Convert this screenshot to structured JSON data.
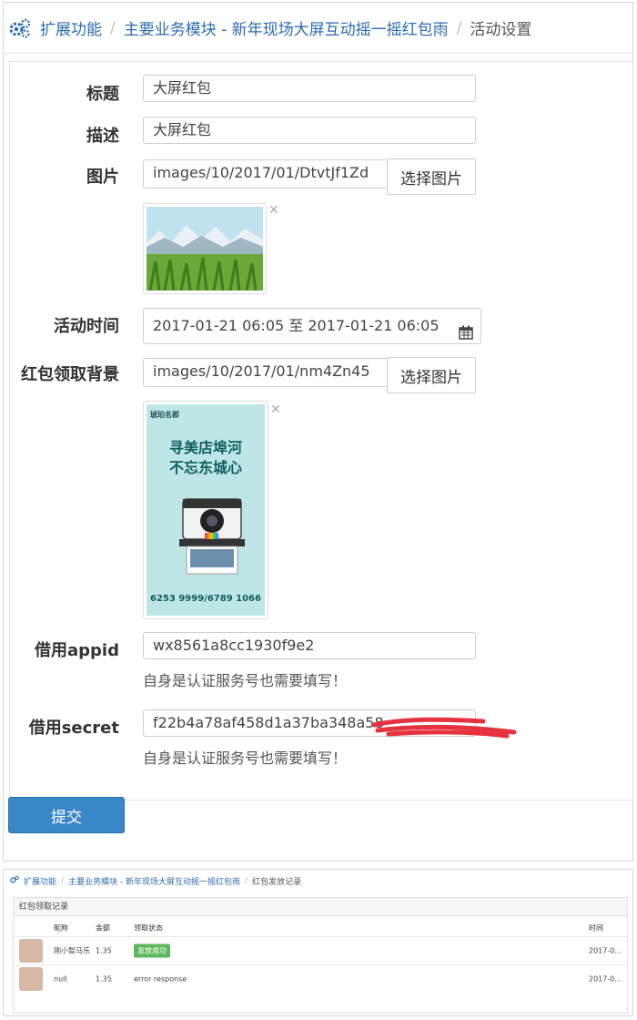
{
  "breadcrumb": {
    "icon": "gears-icon",
    "items": [
      "扩展功能",
      "主要业务模块 - 新年现场大屏互动摇一摇红包雨",
      "活动设置"
    ]
  },
  "form": {
    "title_label": "标题",
    "title_value": "大屏红包",
    "desc_label": "描述",
    "desc_value": "大屏红包",
    "image_label": "图片",
    "image_value": "images/10/2017/01/DtvtJf1Zd",
    "pick_image": "选择图片",
    "time_label": "活动时间",
    "time_value": "2017-01-21 06:05 至 2017-01-21 06:05",
    "bg_label": "红包领取背景",
    "bg_value": "images/10/2017/01/nm4Zn45",
    "poster_text": {
      "brand": "琥珀名郡",
      "line1": "寻美店埠河",
      "line2": "不忘东城心",
      "phone": "6253 9999/6789 1066"
    },
    "appid_label": "借用appid",
    "appid_value": "wx8561a8cc1930f9e2",
    "appid_help": "自身是认证服务号也需要填写！",
    "secret_label": "借用secret",
    "secret_value": "f22b4a78af458d1a37ba348a58",
    "secret_help": "自身是认证服务号也需要填写！",
    "submit": "提交"
  },
  "records": {
    "breadcrumb": [
      "扩展功能",
      "主要业务模块 - 新年现场大屏互动摇一摇红包雨",
      "红包发放记录"
    ],
    "panel_title": "红包领取记录",
    "columns": [
      "昵称",
      "金额",
      "领取状态",
      "时间"
    ],
    "rows": [
      {
        "nickname": "刚小智马乐",
        "amount": "1.35",
        "status": "发放成功",
        "time": "2017-0..."
      },
      {
        "nickname": "null",
        "amount": "1.35",
        "status": "error response",
        "time": "2017-0..."
      }
    ]
  },
  "colors": {
    "accent": "#3a87c8",
    "link": "#2b6cb0",
    "success": "#5cb85c",
    "redact": "#e5323e"
  }
}
